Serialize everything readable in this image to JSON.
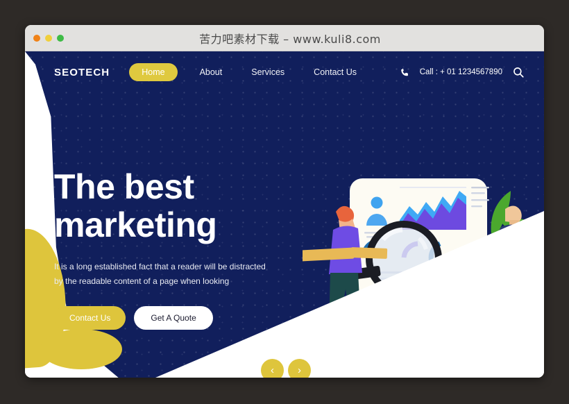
{
  "window": {
    "title": "苦力吧素材下载 – www.kuli8.com",
    "traffic_lights": [
      "close",
      "minimize",
      "maximize"
    ]
  },
  "colors": {
    "navy": "#111f5c",
    "yellow": "#dec53c",
    "white": "#ffffff",
    "outer_background": "#2e2a27",
    "titlebar": "#e2e1df",
    "chart_purple": "#6d4ae0",
    "chart_blue": "#3fa9f5",
    "leaf_green": "#4ba82e",
    "accent_orange": "#e8a33d"
  },
  "nav": {
    "logo": "SEOTECH",
    "items": [
      {
        "label": "Home",
        "active": true
      },
      {
        "label": "About",
        "active": false
      },
      {
        "label": "Services",
        "active": false
      },
      {
        "label": "Contact Us",
        "active": false
      }
    ],
    "phone_icon": "phone-icon",
    "call_text": "Call : + 01 1234567890",
    "search_icon": "search-icon"
  },
  "hero": {
    "title_line1": "The best",
    "title_line2": "marketing",
    "paragraph": "It is a long established fact that a reader will be distracted by the readable content of a page when looking",
    "buttons": [
      {
        "label": "Contact Us",
        "style": "primary"
      },
      {
        "label": "Get A Quote",
        "style": "secondary"
      }
    ]
  },
  "carousel": {
    "prev_icon": "chevron-left-icon",
    "prev_label": "‹",
    "next_icon": "chevron-right-icon",
    "next_label": "›"
  },
  "illustration": {
    "name": "seo-analytics-illustration",
    "card": "white-dashboard-card",
    "elements": [
      "user-avatar-icon",
      "area-chart",
      "text-lines",
      "magnifying-glass-icon",
      "donut-arc-segments",
      "orange-bars",
      "woman-figure",
      "man-figure",
      "green-leaves"
    ],
    "chart_data": {
      "type": "area",
      "title": "",
      "xlabel": "",
      "ylabel": "",
      "grid": false,
      "legend": "none",
      "x": [
        0,
        1,
        2,
        3,
        4,
        5,
        6,
        7,
        8,
        9,
        10
      ],
      "series": [
        {
          "name": "Front area (purple)",
          "color": "#6d4ae0",
          "values": [
            22,
            48,
            30,
            52,
            34,
            60,
            44,
            72,
            56,
            84,
            92
          ]
        },
        {
          "name": "Back area (blue)",
          "color": "#3fa9f5",
          "values": [
            34,
            58,
            42,
            66,
            48,
            74,
            58,
            86,
            70,
            96,
            80
          ]
        }
      ],
      "ylim": [
        0,
        100
      ]
    }
  }
}
